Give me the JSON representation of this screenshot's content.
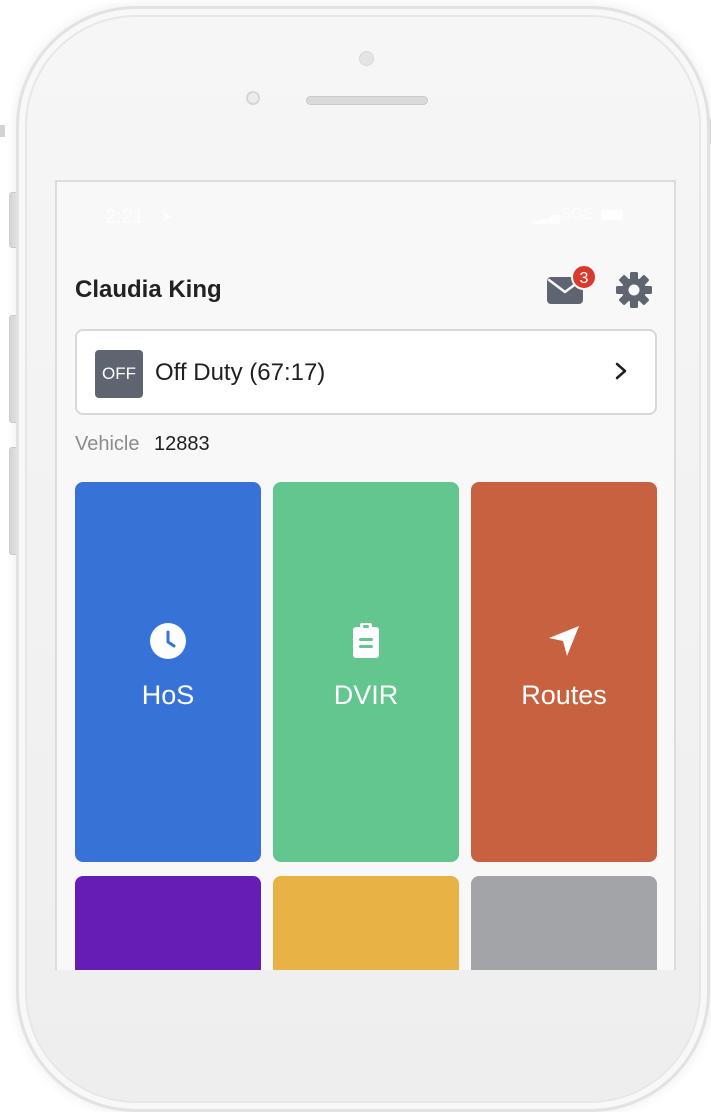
{
  "status_bar": {
    "time": "2:21",
    "location_icon": "location-arrow-icon",
    "network": "5GE",
    "signal_icon": "signal-bars-icon",
    "battery_icon": "battery-icon"
  },
  "header": {
    "driver_name": "Claudia King",
    "messages_icon": "mail-icon",
    "unread_count": "3",
    "settings_icon": "gear-icon"
  },
  "duty_status": {
    "code": "OFF",
    "label": "Off Duty (67:17)",
    "chevron_icon": "chevron-right-icon"
  },
  "vehicle": {
    "label": "Vehicle",
    "value": "12883"
  },
  "tiles": [
    {
      "label": "HoS",
      "icon": "clock-icon",
      "color": "#3773D6"
    },
    {
      "label": "DVIR",
      "icon": "clipboard-icon",
      "color": "#62C68E"
    },
    {
      "label": "Routes",
      "icon": "navigation-arrow-icon",
      "color": "#C8613F"
    },
    {
      "label": "",
      "icon": "",
      "color": "#651DB5"
    },
    {
      "label": "",
      "icon": "",
      "color": "#E8B245"
    },
    {
      "label": "",
      "icon": "",
      "color": "#A3A4A8"
    }
  ],
  "colors": {
    "background": "#F8F8F8",
    "text_primary": "#222222",
    "text_secondary": "#8C8C8C",
    "badge": "#D83B2D",
    "duty_code_bg": "#5F6570"
  }
}
